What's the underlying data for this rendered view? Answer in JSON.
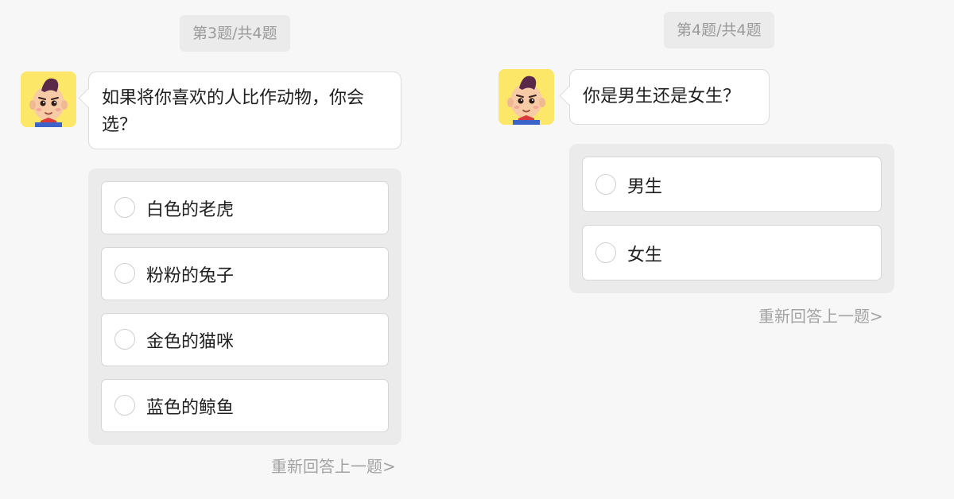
{
  "colors": {
    "background": "#f7f7f7",
    "pill_background": "#ebebeb",
    "muted_text": "#9a9a9a",
    "avatar_background": "#fde768",
    "option_panel": "#ebebeb"
  },
  "left_panel": {
    "progress": "第3题/共4题",
    "avatar_icon": "cartoon-boy-avatar",
    "question": "如果将你喜欢的人比作动物，你会选？",
    "options": [
      "白色的老虎",
      "粉粉的兔子",
      "金色的猫咪",
      "蓝色的鲸鱼"
    ],
    "redo_link": "重新回答上一题>"
  },
  "right_panel": {
    "progress": "第4题/共4题",
    "avatar_icon": "cartoon-boy-avatar",
    "question": "你是男生还是女生？",
    "options": [
      "男生",
      "女生"
    ],
    "redo_link": "重新回答上一题>"
  }
}
